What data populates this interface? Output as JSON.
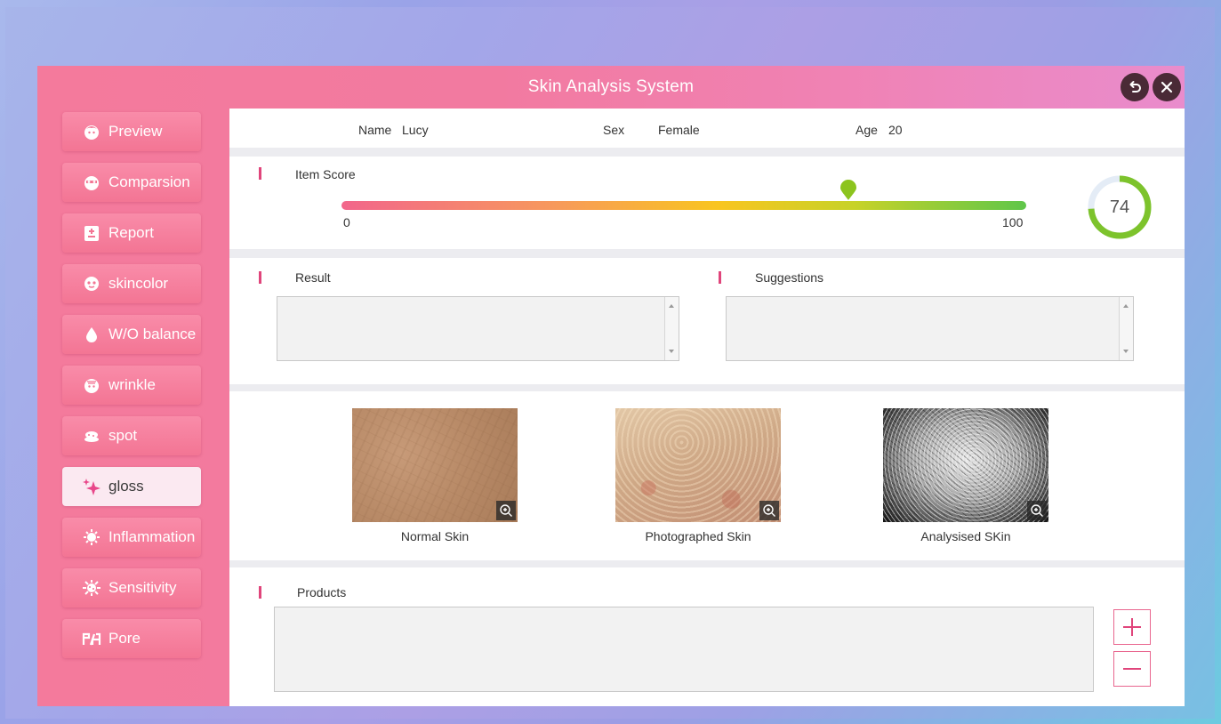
{
  "app": {
    "title": "Skin Analysis System"
  },
  "window_buttons": {
    "back_icon": "back-arrow-icon",
    "close_icon": "close-icon"
  },
  "sidebar": {
    "items": [
      {
        "label": "Preview",
        "icon": "face-icon",
        "active": false
      },
      {
        "label": "Comparsion",
        "icon": "face-compare-icon",
        "active": false
      },
      {
        "label": "Report",
        "icon": "report-icon",
        "active": false
      },
      {
        "label": "skincolor",
        "icon": "face-mask-icon",
        "active": false
      },
      {
        "label": "W/O balance",
        "icon": "water-drop-icon",
        "active": false
      },
      {
        "label": "wrinkle",
        "icon": "wrinkle-face-icon",
        "active": false
      },
      {
        "label": "spot",
        "icon": "spot-icon",
        "active": false
      },
      {
        "label": "gloss",
        "icon": "sparkle-icon",
        "active": true
      },
      {
        "label": "Inflammation",
        "icon": "virus-icon",
        "active": false
      },
      {
        "label": "Sensitivity",
        "icon": "sensitivity-icon",
        "active": false
      },
      {
        "label": "Pore",
        "icon": "pore-icon",
        "active": false
      }
    ]
  },
  "patient": {
    "name_label": "Name",
    "name_value": "Lucy",
    "sex_label": "Sex",
    "sex_value": "Female",
    "age_label": "Age",
    "age_value": "20"
  },
  "item_score": {
    "title": "Item Score",
    "min_label": "0",
    "max_label": "100",
    "value": 74,
    "score_text": "74",
    "ring_color": "#7dc32c",
    "ring_track_color": "#e4ecf6"
  },
  "result": {
    "title": "Result",
    "value": ""
  },
  "suggestions": {
    "title": "Suggestions",
    "value": ""
  },
  "images": [
    {
      "caption": "Normal Skin",
      "icon": "zoom-in-icon"
    },
    {
      "caption": "Photographed Skin",
      "icon": "zoom-in-icon"
    },
    {
      "caption": "Analysised SKin",
      "icon": "zoom-in-icon"
    }
  ],
  "products": {
    "title": "Products",
    "value": "",
    "add_icon": "plus-icon",
    "remove_icon": "minus-icon"
  },
  "colors": {
    "accent": "#e0457b",
    "sidebar_button": "#f37594",
    "active_button": "#fbe9f1"
  }
}
